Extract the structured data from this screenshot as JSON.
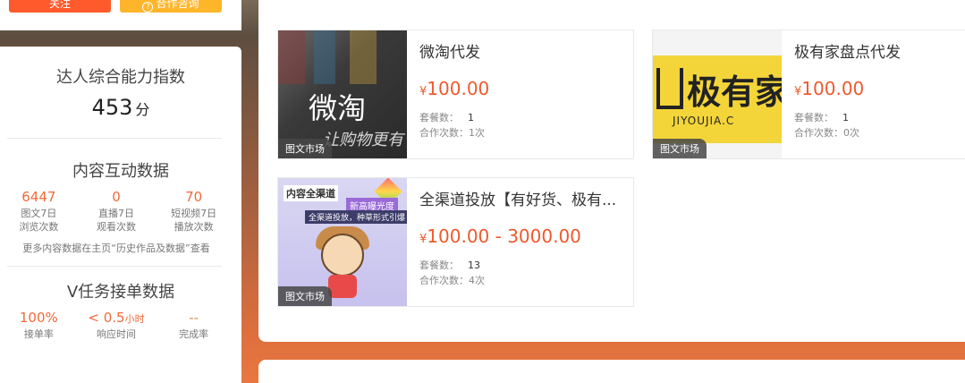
{
  "top_buttons": {
    "follow_label": "关注",
    "cooperate_label": "合作咨询"
  },
  "sidebar": {
    "ability": {
      "title": "达人综合能力指数",
      "score": "453",
      "unit": "分"
    },
    "interaction": {
      "title": "内容互动数据",
      "stats": [
        {
          "value": "6447",
          "label1": "图文7日",
          "label2": "浏览次数"
        },
        {
          "value": "0",
          "label1": "直播7日",
          "label2": "观看次数"
        },
        {
          "value": "70",
          "label1": "短视频7日",
          "label2": "播放次数"
        }
      ],
      "note": "更多内容数据在主页“历史作品及数据”查看"
    },
    "vtask": {
      "title": "V任务接单数据",
      "stats": [
        {
          "value": "100%",
          "unit": "",
          "label": "接单率"
        },
        {
          "value": "< 0.5",
          "unit": "小时",
          "label": "响应时间"
        },
        {
          "value": "--",
          "unit": "",
          "label": "完成率"
        }
      ]
    }
  },
  "cards": [
    {
      "title": "微淘代发",
      "currency": "¥",
      "price": "100.00",
      "tag": "图文市场",
      "package_label": "套餐数：",
      "package_count": "1",
      "coop_label": "合作次数：",
      "coop_count": "1次",
      "thumb_text": "微淘",
      "thumb_sub": "让购物更有"
    },
    {
      "title": "极有家盘点代发",
      "currency": "¥",
      "price": "100.00",
      "tag": "图文市场",
      "package_label": "套餐数：",
      "package_count": "1",
      "coop_label": "合作次数：",
      "coop_count": "0次",
      "thumb_text": "极有家",
      "thumb_sub": "JIYOUJIA.C"
    },
    {
      "title": "全渠道投放【有好货、极有...",
      "currency": "¥",
      "price": "100.00 - 3000.00",
      "tag": "图文市场",
      "package_label": "套餐数：",
      "package_count": "13",
      "coop_label": "合作次数：",
      "coop_count": "4次",
      "thumb_text": "内容全渠道",
      "thumb_sub": "新高曝光度",
      "thumb_sub2": "全渠道投放，种草形式引爆"
    }
  ]
}
